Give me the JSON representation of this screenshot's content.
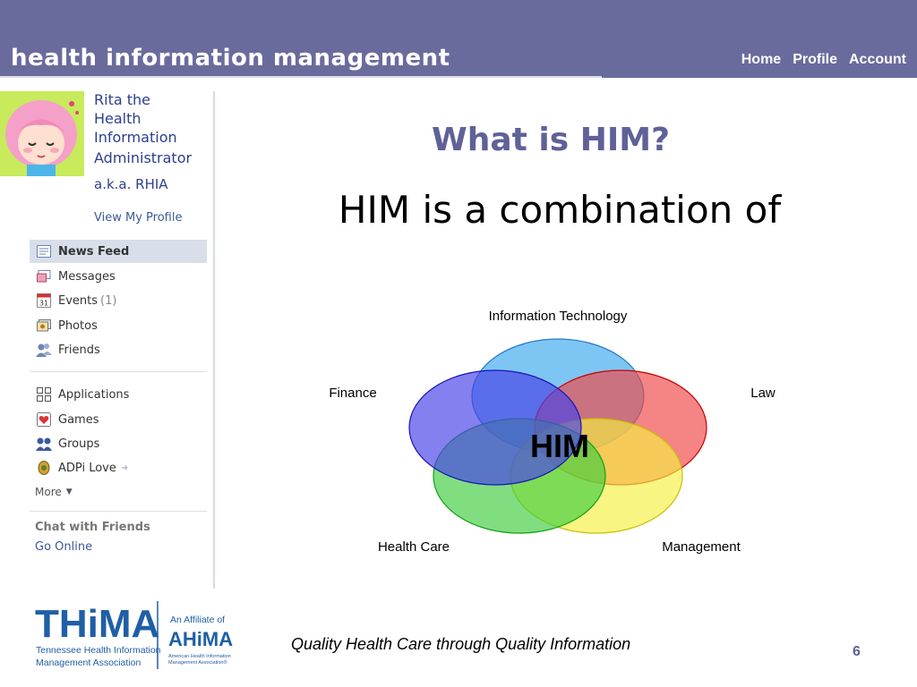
{
  "header": {
    "site_title": "health information management",
    "nav": [
      "Home",
      "Profile",
      "Account"
    ]
  },
  "profile": {
    "name_lines": [
      "Rita the",
      "Health",
      "Information",
      "Administrator"
    ],
    "aka": "a.k.a. RHIA",
    "view_profile": "View My Profile"
  },
  "sidebar": {
    "items": [
      {
        "label": "News Feed",
        "icon": "news-feed-icon",
        "active": true
      },
      {
        "label": "Messages",
        "icon": "messages-icon"
      },
      {
        "label": "Events",
        "count": "(1)",
        "icon": "calendar-icon",
        "icon_text": "31"
      },
      {
        "label": "Photos",
        "icon": "photos-icon"
      },
      {
        "label": "Friends",
        "icon": "friends-icon"
      },
      {
        "label": "Applications",
        "icon": "applications-icon"
      },
      {
        "label": "Games",
        "icon": "games-icon"
      },
      {
        "label": "Groups",
        "icon": "groups-icon"
      },
      {
        "label": "ADPi Love",
        "icon": "adpi-icon"
      }
    ],
    "more": "More",
    "chat_title": "Chat with Friends",
    "chat_status": "Go Online"
  },
  "main": {
    "title": "What is HIM?",
    "subtitle": "HIM is a combination of"
  },
  "venn": {
    "center_label": "HIM",
    "circles": [
      {
        "label": "Information Technology",
        "color": "#5cb8f0"
      },
      {
        "label": "Law",
        "color": "#f04a4a"
      },
      {
        "label": "Management",
        "color": "#f5f040"
      },
      {
        "label": "Health Care",
        "color": "#3ccc3c"
      },
      {
        "label": "Finance",
        "color": "#4a44e8"
      }
    ]
  },
  "footer": {
    "logo_main": "THiMA",
    "logo_sub1": "Tennessee Health Information",
    "logo_sub2": "Management Association",
    "affiliate_text": "An Affiliate of",
    "affiliate_logo": "AHiMA",
    "affiliate_sub1": "American Health Information",
    "affiliate_sub2": "Management Association®",
    "tagline": "Quality Health Care through Quality Information",
    "page_number": "6"
  },
  "colors": {
    "header_bg": "#6a6b9d",
    "title": "#5f6198",
    "link": "#3b5998"
  }
}
